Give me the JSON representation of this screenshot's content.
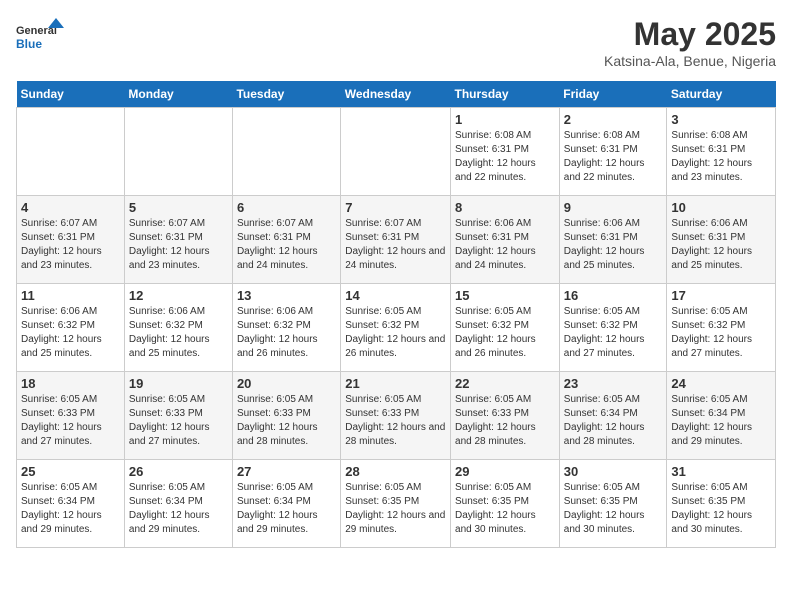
{
  "header": {
    "logo_line1": "General",
    "logo_line2": "Blue",
    "title": "May 2025",
    "location": "Katsina-Ala, Benue, Nigeria"
  },
  "days_of_week": [
    "Sunday",
    "Monday",
    "Tuesday",
    "Wednesday",
    "Thursday",
    "Friday",
    "Saturday"
  ],
  "weeks": [
    [
      {
        "day": "",
        "info": ""
      },
      {
        "day": "",
        "info": ""
      },
      {
        "day": "",
        "info": ""
      },
      {
        "day": "",
        "info": ""
      },
      {
        "day": "1",
        "info": "Sunrise: 6:08 AM\nSunset: 6:31 PM\nDaylight: 12 hours\nand 22 minutes."
      },
      {
        "day": "2",
        "info": "Sunrise: 6:08 AM\nSunset: 6:31 PM\nDaylight: 12 hours\nand 22 minutes."
      },
      {
        "day": "3",
        "info": "Sunrise: 6:08 AM\nSunset: 6:31 PM\nDaylight: 12 hours\nand 23 minutes."
      }
    ],
    [
      {
        "day": "4",
        "info": "Sunrise: 6:07 AM\nSunset: 6:31 PM\nDaylight: 12 hours\nand 23 minutes."
      },
      {
        "day": "5",
        "info": "Sunrise: 6:07 AM\nSunset: 6:31 PM\nDaylight: 12 hours\nand 23 minutes."
      },
      {
        "day": "6",
        "info": "Sunrise: 6:07 AM\nSunset: 6:31 PM\nDaylight: 12 hours\nand 24 minutes."
      },
      {
        "day": "7",
        "info": "Sunrise: 6:07 AM\nSunset: 6:31 PM\nDaylight: 12 hours\nand 24 minutes."
      },
      {
        "day": "8",
        "info": "Sunrise: 6:06 AM\nSunset: 6:31 PM\nDaylight: 12 hours\nand 24 minutes."
      },
      {
        "day": "9",
        "info": "Sunrise: 6:06 AM\nSunset: 6:31 PM\nDaylight: 12 hours\nand 25 minutes."
      },
      {
        "day": "10",
        "info": "Sunrise: 6:06 AM\nSunset: 6:31 PM\nDaylight: 12 hours\nand 25 minutes."
      }
    ],
    [
      {
        "day": "11",
        "info": "Sunrise: 6:06 AM\nSunset: 6:32 PM\nDaylight: 12 hours\nand 25 minutes."
      },
      {
        "day": "12",
        "info": "Sunrise: 6:06 AM\nSunset: 6:32 PM\nDaylight: 12 hours\nand 25 minutes."
      },
      {
        "day": "13",
        "info": "Sunrise: 6:06 AM\nSunset: 6:32 PM\nDaylight: 12 hours\nand 26 minutes."
      },
      {
        "day": "14",
        "info": "Sunrise: 6:05 AM\nSunset: 6:32 PM\nDaylight: 12 hours\nand 26 minutes."
      },
      {
        "day": "15",
        "info": "Sunrise: 6:05 AM\nSunset: 6:32 PM\nDaylight: 12 hours\nand 26 minutes."
      },
      {
        "day": "16",
        "info": "Sunrise: 6:05 AM\nSunset: 6:32 PM\nDaylight: 12 hours\nand 27 minutes."
      },
      {
        "day": "17",
        "info": "Sunrise: 6:05 AM\nSunset: 6:32 PM\nDaylight: 12 hours\nand 27 minutes."
      }
    ],
    [
      {
        "day": "18",
        "info": "Sunrise: 6:05 AM\nSunset: 6:33 PM\nDaylight: 12 hours\nand 27 minutes."
      },
      {
        "day": "19",
        "info": "Sunrise: 6:05 AM\nSunset: 6:33 PM\nDaylight: 12 hours\nand 27 minutes."
      },
      {
        "day": "20",
        "info": "Sunrise: 6:05 AM\nSunset: 6:33 PM\nDaylight: 12 hours\nand 28 minutes."
      },
      {
        "day": "21",
        "info": "Sunrise: 6:05 AM\nSunset: 6:33 PM\nDaylight: 12 hours\nand 28 minutes."
      },
      {
        "day": "22",
        "info": "Sunrise: 6:05 AM\nSunset: 6:33 PM\nDaylight: 12 hours\nand 28 minutes."
      },
      {
        "day": "23",
        "info": "Sunrise: 6:05 AM\nSunset: 6:34 PM\nDaylight: 12 hours\nand 28 minutes."
      },
      {
        "day": "24",
        "info": "Sunrise: 6:05 AM\nSunset: 6:34 PM\nDaylight: 12 hours\nand 29 minutes."
      }
    ],
    [
      {
        "day": "25",
        "info": "Sunrise: 6:05 AM\nSunset: 6:34 PM\nDaylight: 12 hours\nand 29 minutes."
      },
      {
        "day": "26",
        "info": "Sunrise: 6:05 AM\nSunset: 6:34 PM\nDaylight: 12 hours\nand 29 minutes."
      },
      {
        "day": "27",
        "info": "Sunrise: 6:05 AM\nSunset: 6:34 PM\nDaylight: 12 hours\nand 29 minutes."
      },
      {
        "day": "28",
        "info": "Sunrise: 6:05 AM\nSunset: 6:35 PM\nDaylight: 12 hours\nand 29 minutes."
      },
      {
        "day": "29",
        "info": "Sunrise: 6:05 AM\nSunset: 6:35 PM\nDaylight: 12 hours\nand 30 minutes."
      },
      {
        "day": "30",
        "info": "Sunrise: 6:05 AM\nSunset: 6:35 PM\nDaylight: 12 hours\nand 30 minutes."
      },
      {
        "day": "31",
        "info": "Sunrise: 6:05 AM\nSunset: 6:35 PM\nDaylight: 12 hours\nand 30 minutes."
      }
    ]
  ]
}
